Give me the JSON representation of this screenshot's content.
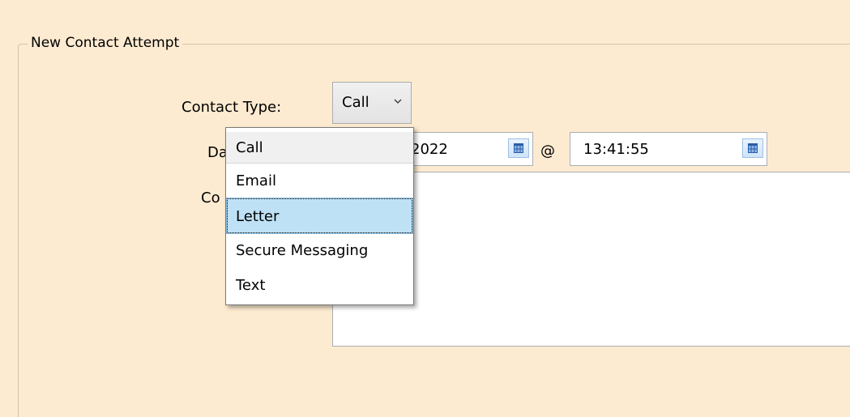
{
  "form": {
    "group_title": "New Contact Attempt",
    "contact_type_label": "Contact Type:",
    "contact_type_value": "Call",
    "date_label_visible": "Da",
    "date_value_visible": "2022",
    "at_sign": "@",
    "time_value": "13:41:55",
    "comments_label_visible": "Co"
  },
  "dropdown": {
    "options": [
      "Call",
      "Email",
      "Letter",
      "Secure Messaging",
      "Text"
    ],
    "selected": "Call",
    "highlighted": "Letter"
  },
  "colors": {
    "background": "#fdebd1",
    "highlight": "#bfe1f5",
    "calendar_button": "#cfe4fa"
  },
  "icons": {
    "combo_arrow": "chevron-down-icon",
    "calendar": "calendar-icon"
  }
}
